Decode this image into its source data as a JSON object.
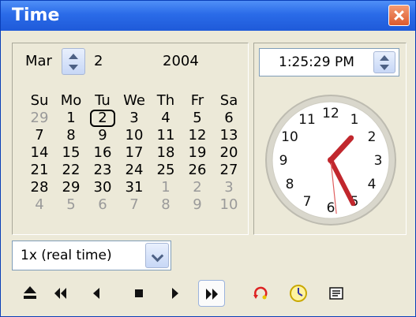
{
  "window": {
    "title": "Time"
  },
  "calendar": {
    "month": "Mar",
    "day": "2",
    "year": "2004",
    "weekdays": [
      "Su",
      "Mo",
      "Tu",
      "We",
      "Th",
      "Fr",
      "Sa"
    ],
    "weeks": [
      [
        {
          "d": "29",
          "o": true
        },
        {
          "d": "1"
        },
        {
          "d": "2",
          "sel": true
        },
        {
          "d": "3"
        },
        {
          "d": "4"
        },
        {
          "d": "5"
        },
        {
          "d": "6"
        }
      ],
      [
        {
          "d": "7"
        },
        {
          "d": "8"
        },
        {
          "d": "9"
        },
        {
          "d": "10"
        },
        {
          "d": "11"
        },
        {
          "d": "12"
        },
        {
          "d": "13"
        }
      ],
      [
        {
          "d": "14"
        },
        {
          "d": "15"
        },
        {
          "d": "16"
        },
        {
          "d": "17"
        },
        {
          "d": "18"
        },
        {
          "d": "19"
        },
        {
          "d": "20"
        }
      ],
      [
        {
          "d": "21"
        },
        {
          "d": "22"
        },
        {
          "d": "23"
        },
        {
          "d": "24"
        },
        {
          "d": "25"
        },
        {
          "d": "26"
        },
        {
          "d": "27"
        }
      ],
      [
        {
          "d": "28"
        },
        {
          "d": "29"
        },
        {
          "d": "30"
        },
        {
          "d": "31"
        },
        {
          "d": "1",
          "o": true
        },
        {
          "d": "2",
          "o": true
        },
        {
          "d": "3",
          "o": true
        }
      ],
      [
        {
          "d": "4",
          "o": true
        },
        {
          "d": "5",
          "o": true
        },
        {
          "d": "6",
          "o": true
        },
        {
          "d": "7",
          "o": true
        },
        {
          "d": "8",
          "o": true
        },
        {
          "d": "9",
          "o": true
        },
        {
          "d": "10",
          "o": true
        }
      ]
    ]
  },
  "clock": {
    "time_text": "1:25:29 PM",
    "hour": 1,
    "minute": 25,
    "second": 29,
    "numerals": [
      "12",
      "1",
      "2",
      "3",
      "4",
      "5",
      "6",
      "7",
      "8",
      "9",
      "10",
      "11"
    ],
    "hand_color": "#c1272d"
  },
  "speed": {
    "value": "1x (real time)"
  },
  "toolbar": {
    "buttons": [
      {
        "name": "eject-icon",
        "active": false
      },
      {
        "name": "rewind-icon",
        "active": false
      },
      {
        "name": "step-back-icon",
        "active": false
      },
      {
        "name": "stop-icon",
        "active": false
      },
      {
        "name": "play-icon",
        "active": false
      },
      {
        "name": "fast-forward-icon",
        "active": true
      },
      {
        "name": "loop-icon",
        "active": false
      },
      {
        "name": "clock-sync-icon",
        "active": false
      },
      {
        "name": "details-icon",
        "active": false
      }
    ]
  }
}
